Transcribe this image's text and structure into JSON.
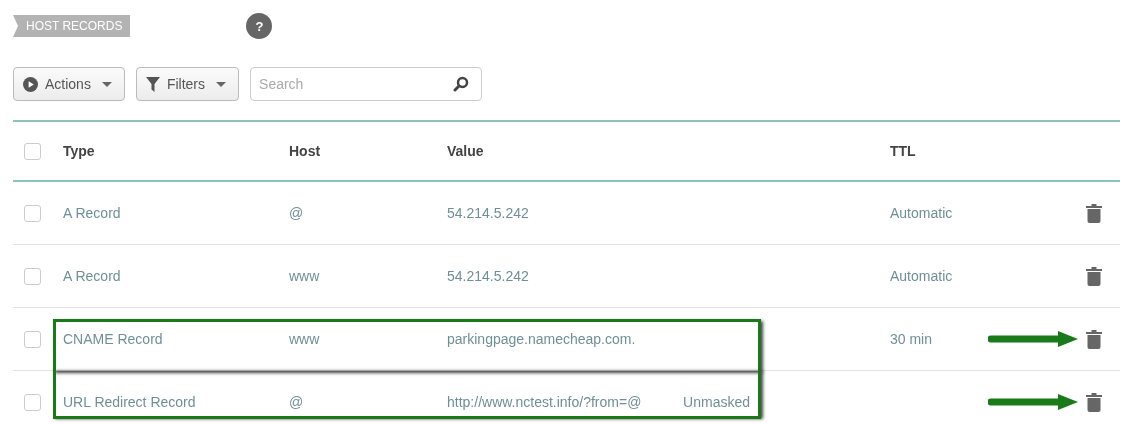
{
  "section": {
    "title": "HOST RECORDS",
    "help": "?"
  },
  "toolbar": {
    "buttons": [
      {
        "kind": "actions",
        "label": "Actions"
      },
      {
        "kind": "filters",
        "label": "Filters"
      }
    ],
    "search": {
      "placeholder": "Search"
    }
  },
  "table": {
    "all_checked": false,
    "columns": [
      "Type",
      "Host",
      "Value",
      "TTL"
    ],
    "rows": [
      {
        "checked": false,
        "type": "A Record",
        "host": "@",
        "value": "54.214.5.242",
        "ttl": "Automatic",
        "highlighted": false,
        "arrow": false
      },
      {
        "checked": false,
        "type": "A Record",
        "host": "www",
        "value": "54.214.5.242",
        "ttl": "Automatic",
        "highlighted": false,
        "arrow": false
      },
      {
        "checked": false,
        "type": "CNAME Record",
        "host": "www",
        "value": "parkingpage.namecheap.com.",
        "ttl": "30 min",
        "highlighted": true,
        "arrow": true
      },
      {
        "checked": false,
        "type": "URL Redirect Record",
        "host": "@",
        "value": "http://www.nctest.info/?from=@",
        "value_note": "Unmasked",
        "highlighted": true,
        "arrow": true
      }
    ]
  }
}
